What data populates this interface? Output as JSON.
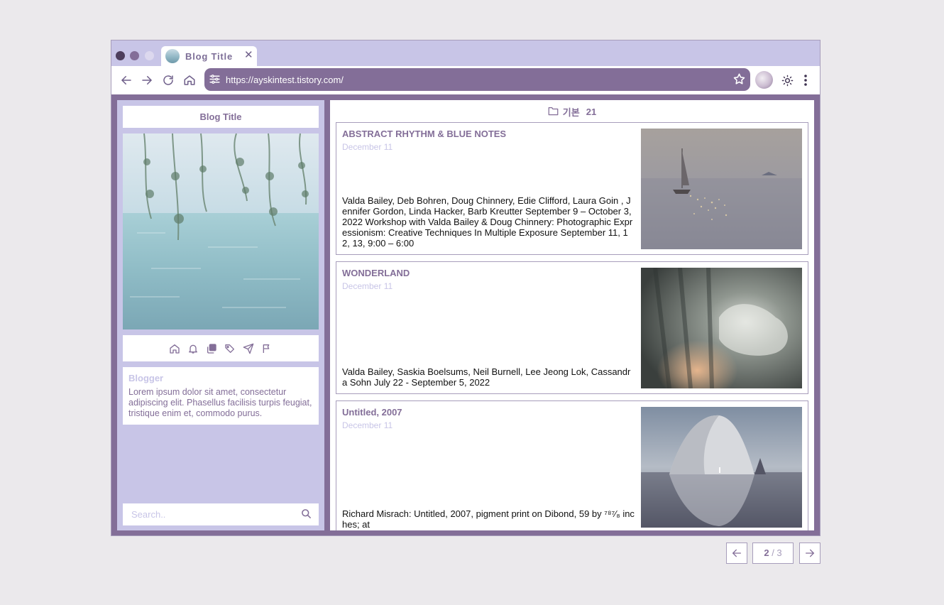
{
  "browser": {
    "tab_title": "Blog Title",
    "url": "https://ayskintest.tistory.com/"
  },
  "sidebar": {
    "title": "Blog Title",
    "icons": [
      "home-icon",
      "bell-icon",
      "copy-icon",
      "tags-icon",
      "send-icon",
      "flag-icon"
    ],
    "blogger_label": "Blogger",
    "blogger_desc": "Lorem ipsum dolor sit amet, consectetur adipiscing elit. Phasellus facilisis turpis feugiat, tristique enim et, commodo purus.",
    "search_placeholder": "Search.."
  },
  "main": {
    "category_label": "기본",
    "category_count": "21",
    "posts": [
      {
        "title": "ABSTRACT RHYTHM & BLUE NOTES",
        "date": "December 11",
        "excerpt": "Valda Bailey, Deb Bohren, Doug Chinnery, Edie Clifford, Laura Goin , Jennifer Gordon, Linda Hacker, Barb Kreutter September 9 – October 3, 2022 Workshop with Valda Bailey & Doug Chinnery: Photographic Expressionism: Creative Techniques In Multiple Exposure September 11, 12, 13, 9:00 – 6:00"
      },
      {
        "title": "WONDERLAND",
        "date": "December 11",
        "excerpt": "Valda Bailey, Saskia Boelsums, Neil Burnell, Lee Jeong Lok, Cassandra Sohn July 22 - September 5, 2022"
      },
      {
        "title": "Untitled, 2007",
        "date": "December 11",
        "excerpt": "Richard Misrach: Untitled, 2007, pigment print on Dibond, 59 by ⁷⁸⁷⁄₈ inches; at"
      }
    ]
  },
  "pager": {
    "current": "2",
    "separator": " / ",
    "total": "3"
  },
  "colors": {
    "primary": "#836e98",
    "light": "#c8c5e7",
    "border": "#a79dbb",
    "page_bg": "#ebe9ec"
  }
}
